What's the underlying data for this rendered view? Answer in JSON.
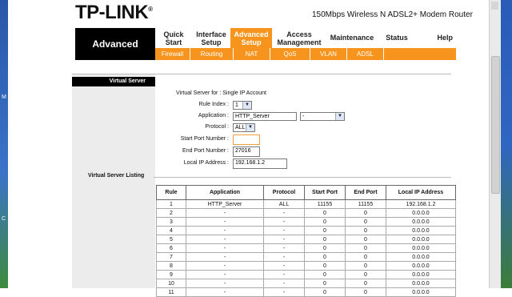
{
  "header": {
    "logo": "TP-LINK",
    "model": "150Mbps Wireless N ADSL2+ Modem Router"
  },
  "side": {
    "section": "Advanced",
    "panel_title": "Virtual Server",
    "list_title": "Virtual Server Listing"
  },
  "menu": {
    "items": [
      {
        "l1": "Quick",
        "l2": "Start"
      },
      {
        "l1": "Interface",
        "l2": "Setup"
      },
      {
        "l1": "Advanced",
        "l2": "Setup"
      },
      {
        "l1": "Access",
        "l2": "Management"
      },
      {
        "l1": "Maintenance",
        "l2": ""
      },
      {
        "l1": "Status",
        "l2": ""
      },
      {
        "l1": "Help",
        "l2": ""
      }
    ]
  },
  "submenu": {
    "items": [
      "Firewall",
      "Routing",
      "NAT",
      "QoS",
      "VLAN",
      "ADSL",
      ""
    ]
  },
  "form": {
    "account_label": "Virtual Server for : Single IP Account",
    "rule_index_label": "Rule Index :",
    "rule_index_value": "1",
    "application_label": "Application :",
    "application_value": "HTTP_Server",
    "application_select": "-",
    "protocol_label": "Protocol :",
    "protocol_value": "ALL",
    "start_port_label": "Start Port Number :",
    "start_port_value": "",
    "end_port_label": "End Port Number :",
    "end_port_value": "27016",
    "local_ip_label": "Local IP Address :",
    "local_ip_value": "192.168.1.2"
  },
  "table": {
    "headers": [
      "Rule",
      "Application",
      "Protocol",
      "Start Port",
      "End Port",
      "Local IP Address"
    ],
    "rows": [
      [
        "1",
        "HTTP_Server",
        "ALL",
        "11155",
        "11155",
        "192.168.1.2"
      ],
      [
        "2",
        "-",
        "-",
        "0",
        "0",
        "0.0.0.0"
      ],
      [
        "3",
        "-",
        "-",
        "0",
        "0",
        "0.0.0.0"
      ],
      [
        "4",
        "-",
        "-",
        "0",
        "0",
        "0.0.0.0"
      ],
      [
        "5",
        "-",
        "-",
        "0",
        "0",
        "0.0.0.0"
      ],
      [
        "6",
        "-",
        "-",
        "0",
        "0",
        "0.0.0.0"
      ],
      [
        "7",
        "-",
        "-",
        "0",
        "0",
        "0.0.0.0"
      ],
      [
        "8",
        "-",
        "-",
        "0",
        "0",
        "0.0.0.0"
      ],
      [
        "9",
        "-",
        "-",
        "0",
        "0",
        "0.0.0.0"
      ],
      [
        "10",
        "-",
        "-",
        "0",
        "0",
        "0.0.0.0"
      ],
      [
        "11",
        "-",
        "-",
        "0",
        "0",
        "0.0.0.0"
      ]
    ]
  },
  "colors": {
    "accent": "#f7941d",
    "sidebar": "#000000"
  }
}
